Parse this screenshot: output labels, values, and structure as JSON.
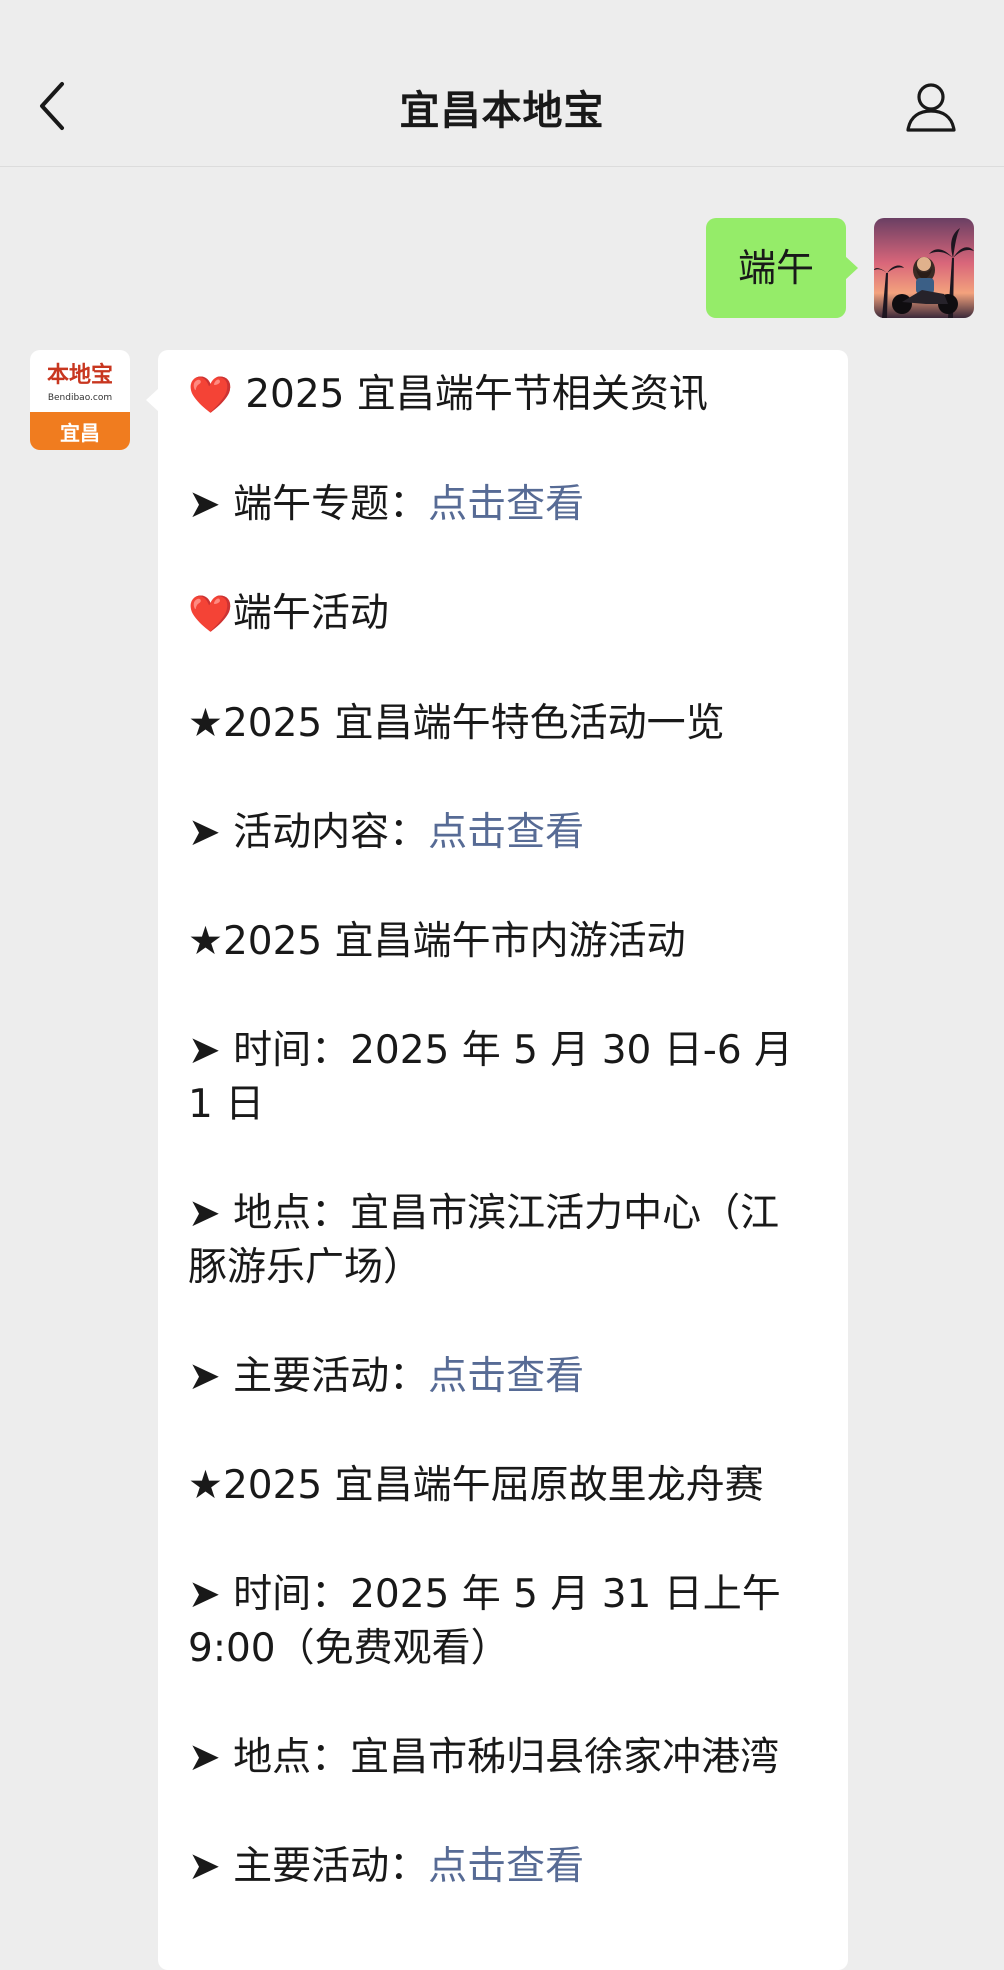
{
  "header": {
    "title": "宜昌本地宝"
  },
  "outgoing": {
    "text": "端午"
  },
  "account_avatar": {
    "line1": "本地宝",
    "line2": "Bendibao.com",
    "line3": "宜昌"
  },
  "message": {
    "p1": {
      "heart": "❤️",
      "text": "2025 宜昌端午节相关资讯"
    },
    "p2": {
      "arrow": "➤",
      "label": "端午专题：",
      "link": "点击查看"
    },
    "p3": {
      "heart": "❤️",
      "text": "端午活动"
    },
    "p4": {
      "text": "★2025 宜昌端午特色活动一览"
    },
    "p5": {
      "arrow": "➤",
      "label": "活动内容：",
      "link": "点击查看"
    },
    "p6": {
      "text": "★2025 宜昌端午市内游活动"
    },
    "p7": {
      "arrow": "➤",
      "text": "时间：2025 年 5 月 30 日-6 月 1 日"
    },
    "p8": {
      "arrow": "➤",
      "text": "地点：宜昌市滨江活力中心（江豚游乐广场）"
    },
    "p9": {
      "arrow": "➤",
      "label": "主要活动：",
      "link": "点击查看"
    },
    "p10": {
      "text": "★2025 宜昌端午屈原故里龙舟赛"
    },
    "p11": {
      "arrow": "➤",
      "text": "时间：2025 年 5 月 31 日上午 9:00（免费观看）"
    },
    "p12": {
      "arrow": "➤",
      "text": "地点：宜昌市秭归县徐家冲港湾"
    },
    "p13": {
      "arrow": "➤",
      "label": "主要活动：",
      "link": "点击查看"
    }
  },
  "colors": {
    "bg": "#ededed",
    "outgoing_bubble": "#95ec69",
    "link": "#576b95",
    "brand_orange": "#f07c1f"
  },
  "icons": {
    "back": "chevron-left-icon",
    "profile": "person-icon"
  }
}
